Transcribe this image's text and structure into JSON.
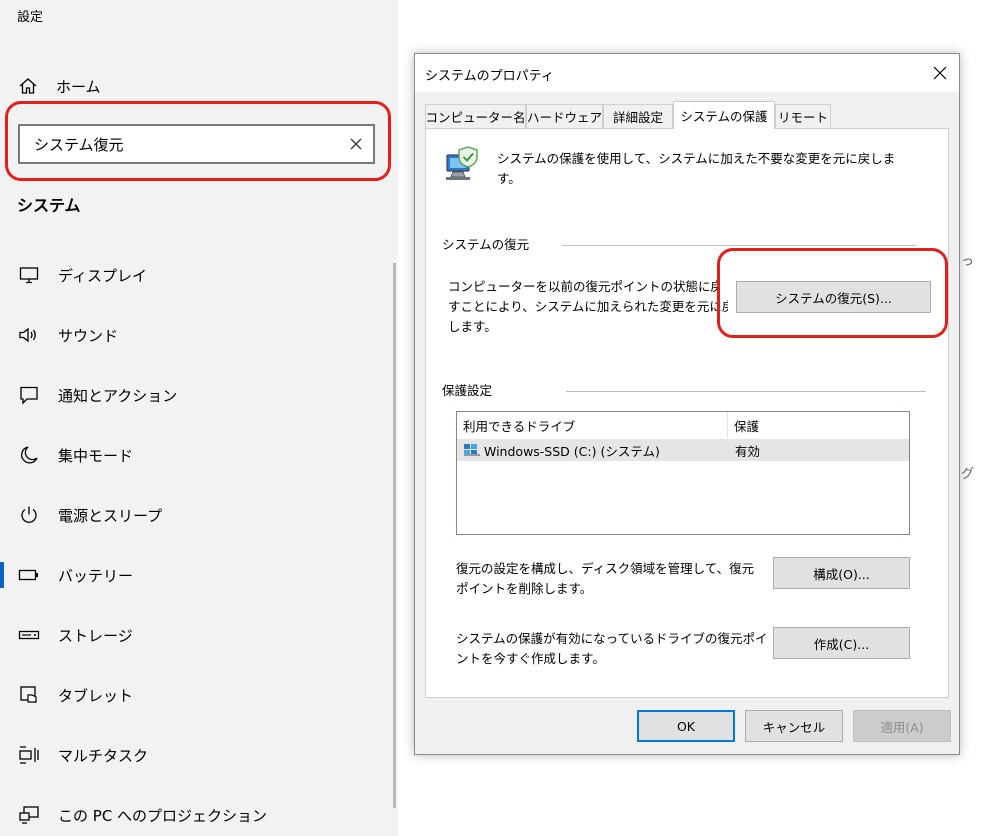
{
  "settings": {
    "app_title": "設定",
    "home_label": "ホーム",
    "search": {
      "value": "システム復元"
    },
    "section_title": "システム",
    "nav": [
      {
        "label": "ディスプレイ",
        "icon": "monitor-icon"
      },
      {
        "label": "サウンド",
        "icon": "speaker-icon"
      },
      {
        "label": "通知とアクション",
        "icon": "notification-icon"
      },
      {
        "label": "集中モード",
        "icon": "moon-icon"
      },
      {
        "label": "電源とスリープ",
        "icon": "power-icon"
      },
      {
        "label": "バッテリー",
        "icon": "battery-icon",
        "active": true
      },
      {
        "label": "ストレージ",
        "icon": "storage-icon"
      },
      {
        "label": "タブレット",
        "icon": "tablet-icon"
      },
      {
        "label": "マルチタスク",
        "icon": "multitask-icon"
      },
      {
        "label": "この PC へのプロジェクション",
        "icon": "projection-icon"
      }
    ],
    "background_fragments": [
      "っ",
      "グ"
    ]
  },
  "dialog": {
    "title": "システムのプロパティ",
    "tabs": [
      {
        "label": "コンピューター名"
      },
      {
        "label": "ハードウェア"
      },
      {
        "label": "詳細設定"
      },
      {
        "label": "システムの保護",
        "active": true
      },
      {
        "label": "リモート"
      }
    ],
    "intro_lines": [
      "システムの保護を使用して、システムに加えた不要な変更を元に戻しま",
      "す。"
    ],
    "restore_group": {
      "title": "システムの復元",
      "desc_lines": [
        "コンピューターを以前の復元ポイントの状態に戻",
        "すことにより、システムに加えられた変更を元に戻",
        "します。"
      ],
      "button": "システムの復元(S)..."
    },
    "protection_group": {
      "title": "保護設定",
      "columns": [
        "利用できるドライブ",
        "保護"
      ],
      "drives": [
        {
          "name": "Windows-SSD (C:) (システム)",
          "status": "有効",
          "icon": "drive-icon"
        }
      ],
      "configure_desc_lines": [
        "復元の設定を構成し、ディスク領域を管理して、復元",
        "ポイントを削除します。"
      ],
      "configure_button": "構成(O)...",
      "create_desc_lines": [
        "システムの保護が有効になっているドライブの復元ポイ",
        "ントを今すぐ作成します。"
      ],
      "create_button": "作成(C)..."
    },
    "buttons": {
      "ok": "OK",
      "cancel": "キャンセル",
      "apply": "適用(A)"
    }
  },
  "colors": {
    "highlight": "#e0201a",
    "accent": "#0078d7",
    "sidebar_bg": "#f2f2f2",
    "dialog_bg": "#f0f0f0"
  }
}
